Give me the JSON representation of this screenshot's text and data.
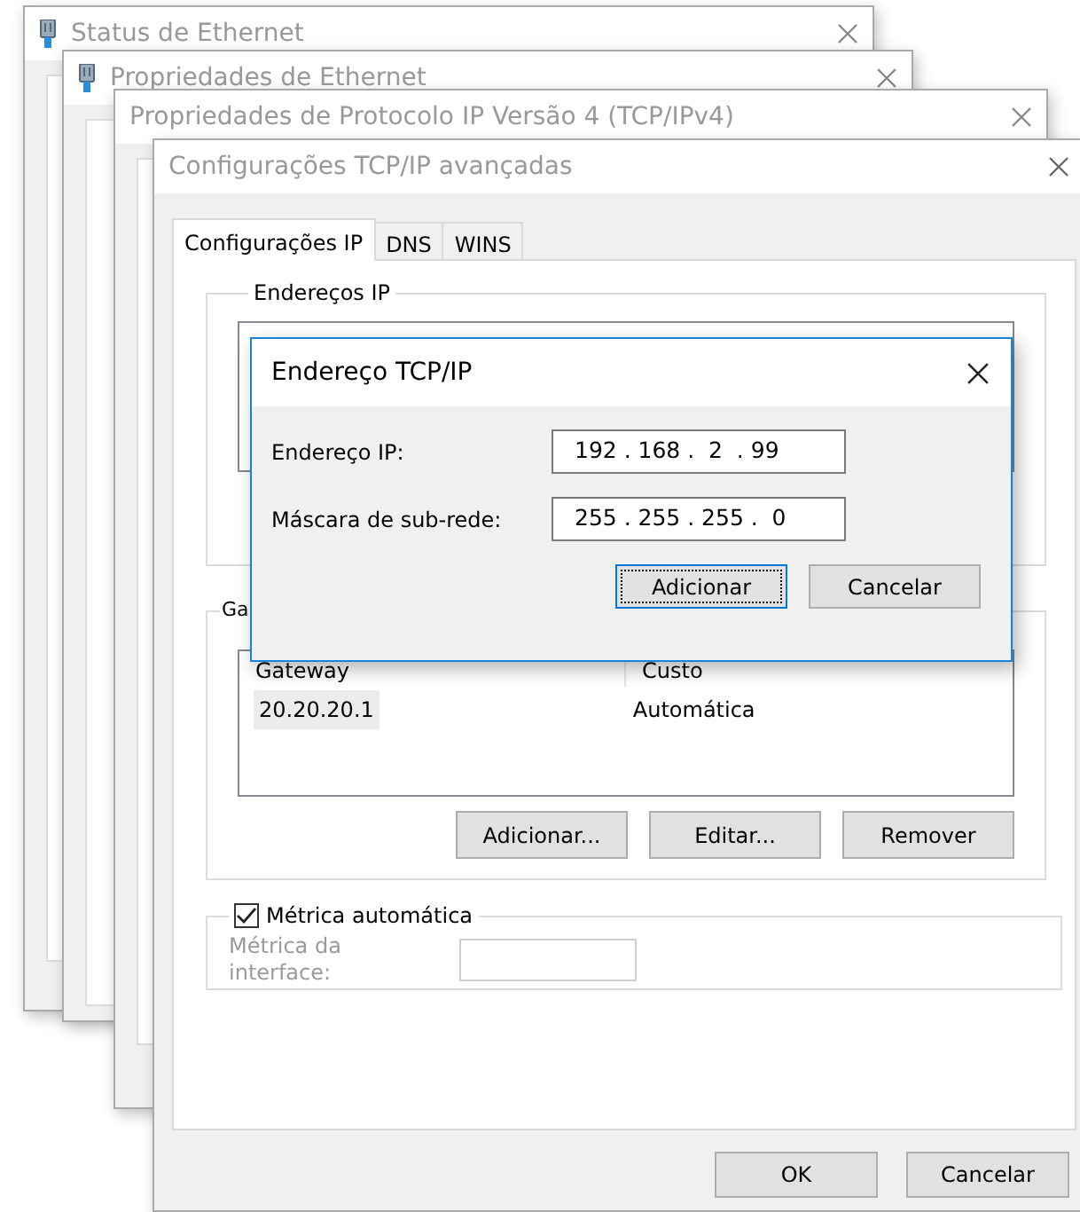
{
  "background_windows": [
    {
      "title": "Status de Ethernet",
      "kind": "ethernet"
    },
    {
      "title": "Propriedades de Ethernet",
      "kind": "ethernet"
    },
    {
      "title": "Propriedades de Protocolo IP Versão 4 (TCP/IPv4)",
      "kind": "plain"
    }
  ],
  "main_window": {
    "title": "Configurações TCP/IP avançadas",
    "tabs": [
      {
        "label": "Configurações IP",
        "selected": true
      },
      {
        "label": "DNS",
        "selected": false
      },
      {
        "label": "WINS",
        "selected": false
      }
    ],
    "ip_group": {
      "label": "Endereços IP"
    },
    "gateway_group": {
      "label": "Ga",
      "columns": [
        "Gateway",
        "Custo"
      ],
      "rows": [
        {
          "cells": [
            "20.20.20.1",
            "Automática"
          ],
          "selected": true
        }
      ],
      "buttons": [
        "Adicionar...",
        "Editar...",
        "Remover"
      ]
    },
    "metric": {
      "label": "Métrica automática",
      "checked": true,
      "field_label": "Métrica da interface:",
      "disabled": true
    },
    "buttons": [
      "OK",
      "Cancelar"
    ]
  },
  "dialog": {
    "title": "Endereço TCP/IP",
    "fields": [
      {
        "label": "Endereço IP:",
        "value": "192 . 168 .  2  . 99"
      },
      {
        "label": "Máscara de sub-rede:",
        "value": "255 . 255 . 255 .  0"
      }
    ],
    "buttons": [
      {
        "label": "Adicionar",
        "default": true
      },
      {
        "label": "Cancelar",
        "default": false
      }
    ]
  }
}
